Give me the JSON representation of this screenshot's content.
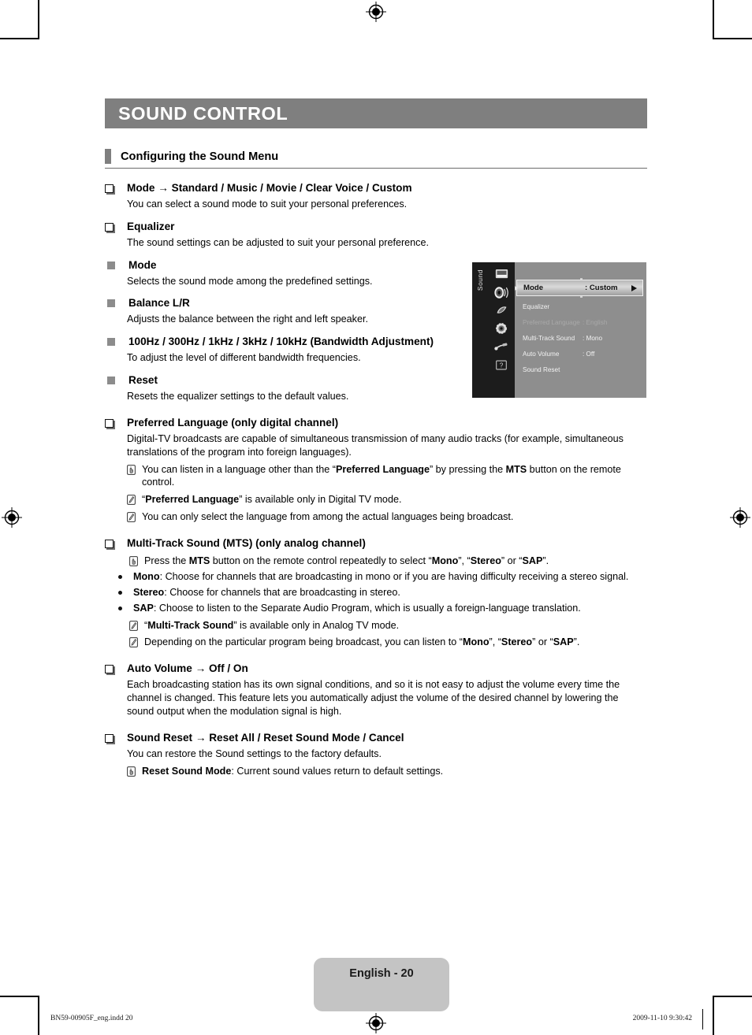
{
  "chapter": {
    "title": "SOUND CONTROL"
  },
  "section": {
    "heading": "Configuring the Sound Menu"
  },
  "items": {
    "mode": {
      "heading": "Mode → Standard / Music / Movie / Clear Voice / Custom",
      "body": "You can select a sound mode to suit your personal preferences."
    },
    "equalizer": {
      "heading": "Equalizer",
      "body": "The sound settings can be adjusted to suit your personal preference.",
      "sub": [
        {
          "heading": "Mode",
          "body": "Selects the sound mode among the predefined settings."
        },
        {
          "heading": "Balance L/R",
          "body": "Adjusts the balance between the right and left speaker."
        },
        {
          "heading": "100Hz / 300Hz / 1kHz / 3kHz / 10kHz (Bandwidth Adjustment)",
          "body": "To adjust the level of different bandwidth frequencies."
        },
        {
          "heading": "Reset",
          "body": "Resets the equalizer settings to the default values."
        }
      ]
    },
    "preferred_language": {
      "heading": "Preferred Language (only digital channel)",
      "body": "Digital-TV broadcasts are capable of simultaneous transmission of many audio tracks (for example, simultaneous translations of the program into foreign languages).",
      "notes": [
        {
          "icon": "hand-press-icon",
          "html": "You can listen in a language other than the “<b>Preferred Language</b>” by pressing the <b>MTS</b> button on the remote control."
        },
        {
          "icon": "note-pencil-icon",
          "html": "“<b>Preferred Language</b>” is available only in Digital TV mode."
        },
        {
          "icon": "note-pencil-icon",
          "html": "You can only select the language from among the actual languages being broadcast."
        }
      ]
    },
    "multi_track_sound": {
      "heading": "Multi-Track Sound (MTS) (only analog channel)",
      "notes_top": [
        {
          "icon": "hand-press-icon",
          "html": "Press the <b>MTS</b> button on the remote control repeatedly to select “<b>Mono</b>”, “<b>Stereo</b>” or “<b>SAP</b>”."
        }
      ],
      "bullets": [
        {
          "html": "<b>Mono</b>: Choose for channels that are broadcasting in mono or if you are having difficulty receiving a stereo signal."
        },
        {
          "html": "<b>Stereo</b>: Choose for channels that are broadcasting in stereo."
        },
        {
          "html": "<b>SAP</b>: Choose to listen to the Separate Audio Program, which is usually a foreign-language translation."
        }
      ],
      "notes_bottom": [
        {
          "icon": "note-pencil-icon",
          "html": "“<b>Multi-Track Sound</b>” is available only in Analog TV mode."
        },
        {
          "icon": "note-pencil-icon",
          "html": "Depending on the particular program being broadcast, you can listen to “<b>Mono</b>”, “<b>Stereo</b>” or “<b>SAP</b>”."
        }
      ]
    },
    "auto_volume": {
      "heading": "Auto Volume → Off / On",
      "body": "Each broadcasting station has its own signal conditions, and so it is not easy to adjust the volume every time the channel is changed. This feature lets you automatically adjust the volume of the desired channel by lowering the sound output when the modulation signal is high."
    },
    "sound_reset": {
      "heading": "Sound Reset → Reset All / Reset Sound Mode / Cancel",
      "body": "You can restore the Sound settings to the factory defaults.",
      "notes": [
        {
          "icon": "hand-press-icon",
          "html": "<b>Reset Sound Mode</b>: Current sound values return to default settings."
        }
      ]
    }
  },
  "osd": {
    "tab_label": "Sound",
    "icons": [
      "picture-icon",
      "sound-icon",
      "channel-icon",
      "setup-icon",
      "input-icon",
      "help-icon"
    ],
    "rows": [
      {
        "label": "Mode",
        "value": ": Custom",
        "state": "highlighted"
      },
      {
        "label": "Equalizer",
        "value": "",
        "state": "normal"
      },
      {
        "label": "Preferred Language",
        "value": ": English",
        "state": "dimmed"
      },
      {
        "label": "Multi-Track Sound",
        "value": ": Mono",
        "state": "normal"
      },
      {
        "label": "Auto Volume",
        "value": ": Off",
        "state": "normal"
      },
      {
        "label": "Sound Reset",
        "value": "",
        "state": "normal"
      }
    ]
  },
  "footer": {
    "page_label": "English - 20",
    "file_info": "BN59-00905F_eng.indd   20",
    "timestamp": "2009-11-10   9:30:42"
  },
  "colors": {
    "title_bar": "#7f7f7f",
    "section_marker": "#7f7f7f",
    "page_badge": "#c4c4c4",
    "osd_background": "#8e8e8e",
    "osd_sidebar": "#1c1c1c"
  }
}
